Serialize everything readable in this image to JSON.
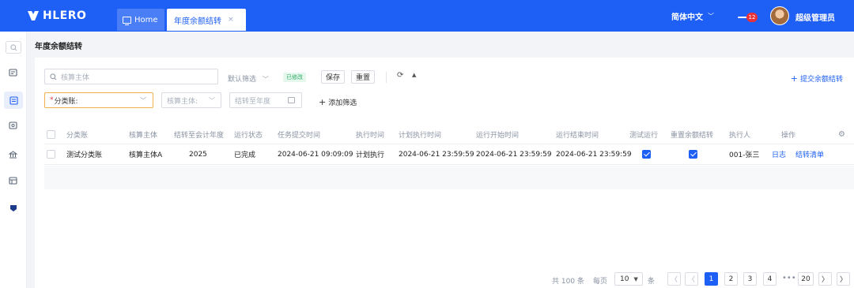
{
  "header": {
    "brand": "HLERO",
    "tabs": [
      {
        "label": "Home"
      },
      {
        "label": "年度余额结转",
        "close": "×"
      }
    ],
    "language": "简体中文",
    "notifications": "12",
    "user": "超级管理员"
  },
  "page": {
    "title": "年度余额结转"
  },
  "toolbar": {
    "search_placeholder": "核算主体",
    "default_filter": "默认筛选",
    "changed_tag": "已修改",
    "save": "保存",
    "reset": "重置",
    "submit": "提交余额结转",
    "category_required": "*",
    "category_label": "分类账:",
    "entity_label": "核算主体:",
    "year_placeholder": "结转至年度",
    "add_filter": "添加筛选"
  },
  "table": {
    "columns": [
      "分类账",
      "核算主体",
      "结转至会计年度",
      "运行状态",
      "任务提交时间",
      "执行时间",
      "计划执行时间",
      "运行开始时间",
      "运行结束时间",
      "测试运行",
      "重置余额结转",
      "执行人",
      "操作"
    ],
    "rows": [
      {
        "ledger": "测试分类账",
        "entity": "核算主体A",
        "year": "2025",
        "status": "已完成",
        "submit_time": "2024-06-21 09:09:09",
        "exec_time": "计划执行",
        "plan_time": "2024-06-21 23:59:59",
        "start_time": "2024-06-21 23:59:59",
        "end_time": "2024-06-21 23:59:59",
        "test_run": true,
        "reset_balance": true,
        "executor": "001-张三",
        "action_log": "日志",
        "action_list": "结转清单"
      }
    ]
  },
  "pagination": {
    "total": "共 100 条",
    "per_page_label": "每页",
    "page_size": "10",
    "unit": "条",
    "pages": [
      "1",
      "2",
      "3",
      "4",
      "20"
    ],
    "ellipsis": "•••",
    "current": "1"
  },
  "colors": {
    "brand": "#1e5ff5",
    "success": "#2eae66",
    "warning_border": "#f0b24a",
    "badge": "#e8313a"
  },
  "icons": {
    "sidebar": [
      "search-icon",
      "report-icon",
      "document-icon",
      "dollar-icon",
      "bank-icon",
      "ledger-icon",
      "shield-icon"
    ]
  }
}
